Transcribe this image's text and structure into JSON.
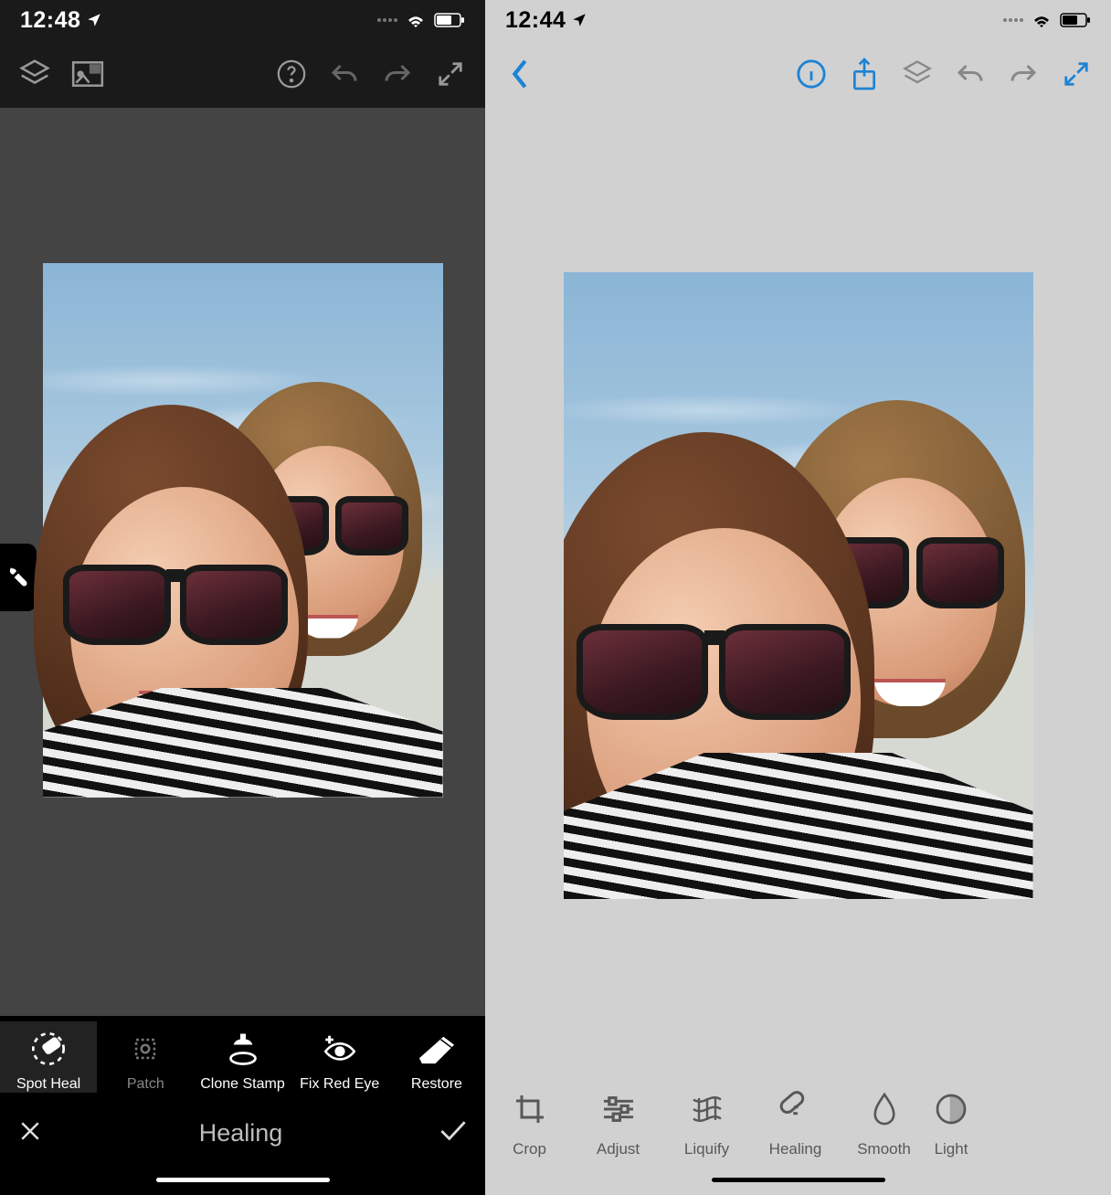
{
  "left": {
    "status": {
      "time": "12:48"
    },
    "mode_title": "Healing",
    "tools": [
      {
        "label": "Spot Heal"
      },
      {
        "label": "Patch"
      },
      {
        "label": "Clone Stamp"
      },
      {
        "label": "Fix Red Eye"
      },
      {
        "label": "Restore"
      }
    ]
  },
  "right": {
    "status": {
      "time": "12:44"
    },
    "tools": [
      {
        "label": "Crop"
      },
      {
        "label": "Adjust"
      },
      {
        "label": "Liquify"
      },
      {
        "label": "Healing"
      },
      {
        "label": "Smooth"
      },
      {
        "label": "Light"
      }
    ]
  },
  "colors": {
    "dark_bg": "#1a1a1a",
    "light_bg": "#d1d1d2",
    "canvas_dark": "#444444",
    "accent_blue": "#1d83d4"
  }
}
